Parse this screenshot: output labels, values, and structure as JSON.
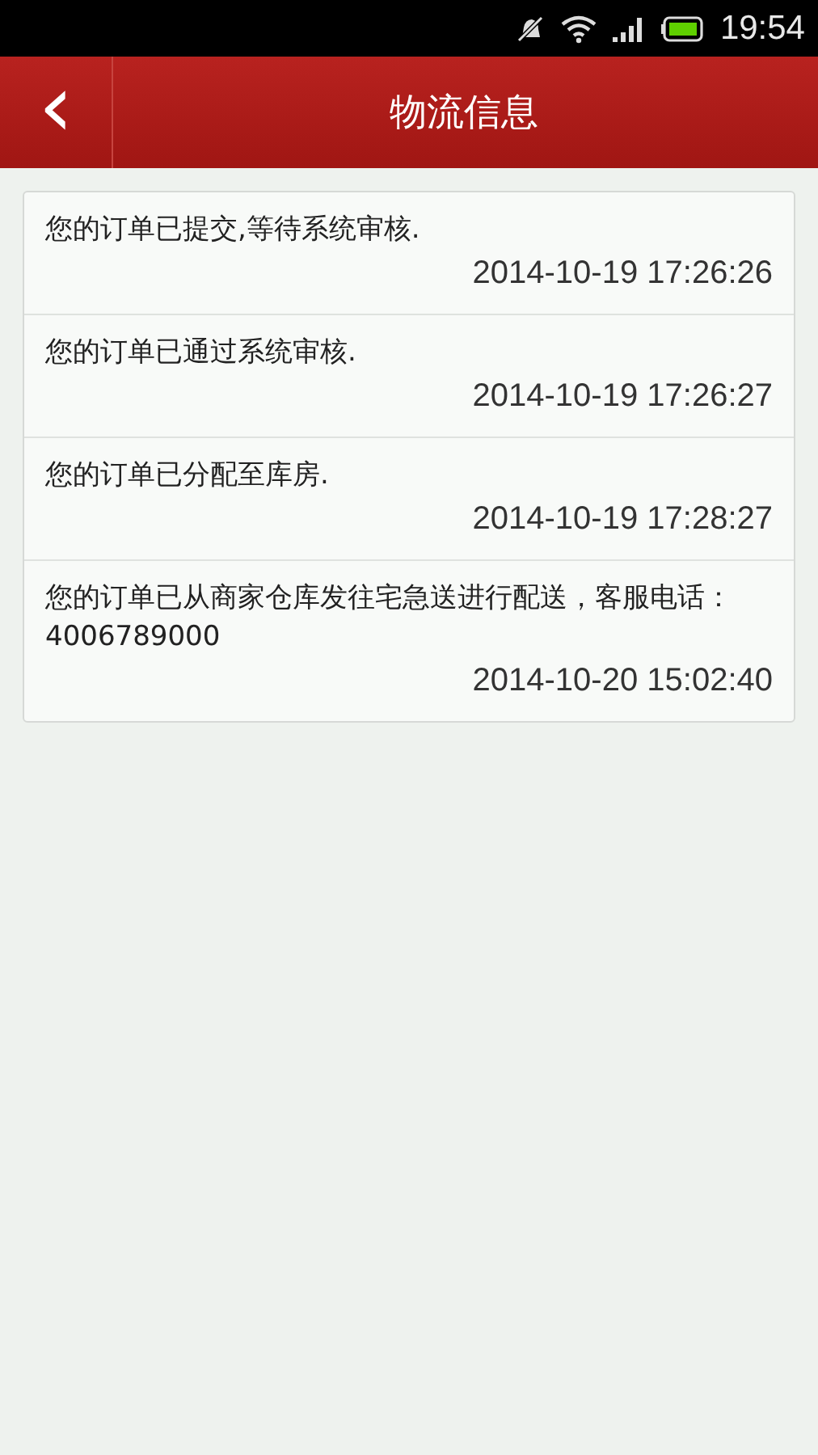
{
  "status_bar": {
    "time": "19:54"
  },
  "header": {
    "back": "‹",
    "title": "物流信息"
  },
  "entries": [
    {
      "message": "您的订单已提交,等待系统审核.",
      "time": "2014-10-19 17:26:26"
    },
    {
      "message": "您的订单已通过系统审核.",
      "time": "2014-10-19 17:26:27"
    },
    {
      "message": "您的订单已分配至库房.",
      "time": "2014-10-19 17:28:27"
    },
    {
      "message": "您的订单已从商家仓库发往宅急送进行配送，客服电话：4006789000",
      "time": "2014-10-20 15:02:40"
    }
  ]
}
